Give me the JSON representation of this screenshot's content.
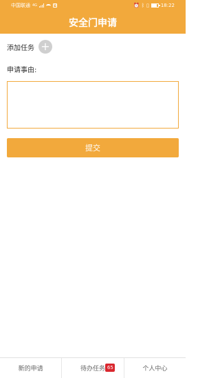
{
  "status_bar": {
    "carrier": "中国联通",
    "network": "4G",
    "time": "18:22",
    "battery_level": 0.85
  },
  "header": {
    "title": "安全门申请"
  },
  "form": {
    "add_task_label": "添加任务",
    "add_icon": "plus-icon",
    "reason_label": "申请事由:",
    "reason_value": "",
    "submit_label": "提交"
  },
  "bottom_nav": {
    "items": [
      {
        "label": "新的申请"
      },
      {
        "label": "待办任务",
        "badge": "65"
      },
      {
        "label": "个人中心"
      }
    ]
  },
  "colors": {
    "accent": "#f2a93c",
    "badge": "#d9272e"
  }
}
